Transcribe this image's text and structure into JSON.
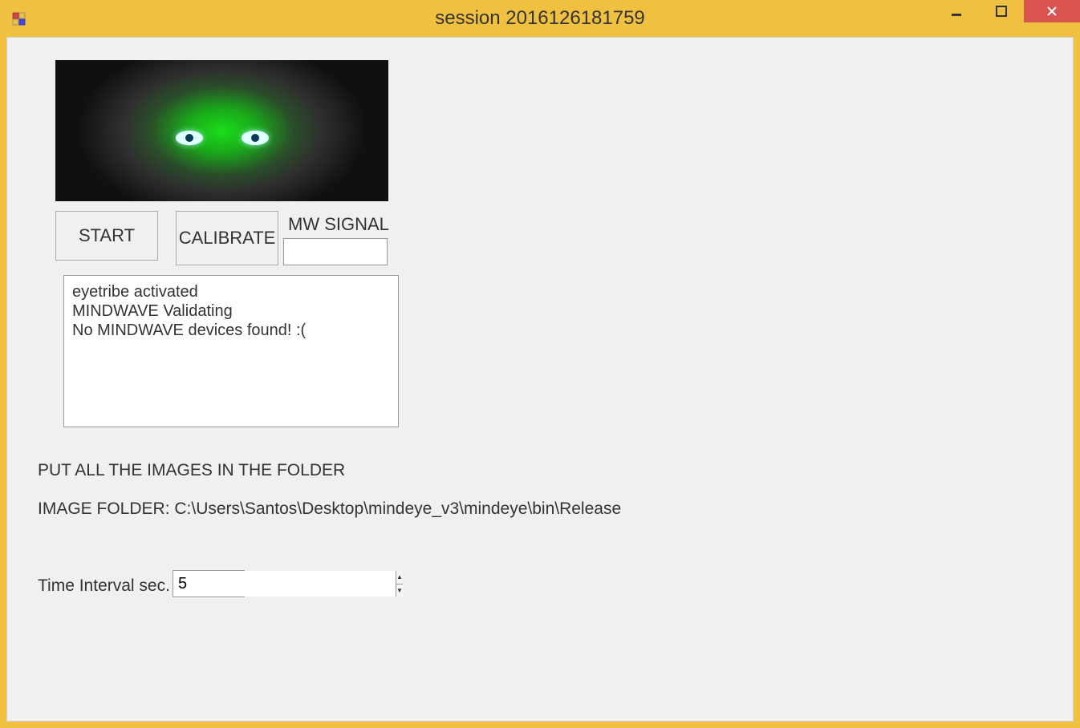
{
  "window": {
    "title": "session 2016126181759"
  },
  "buttons": {
    "start": "START",
    "calibrate": "CALIBRATE"
  },
  "mw_signal": {
    "label": "MW SIGNAL",
    "value": ""
  },
  "log": "eyetribe activated\nMINDWAVE Validating\nNo MINDWAVE devices found! :(",
  "instruction": "PUT ALL THE IMAGES IN THE FOLDER",
  "folder_label": "IMAGE FOLDER: ",
  "folder_path": "C:\\Users\\Santos\\Desktop\\mindeye_v3\\mindeye\\bin\\Release",
  "interval": {
    "label": "Time Interval sec.",
    "value": "5"
  }
}
